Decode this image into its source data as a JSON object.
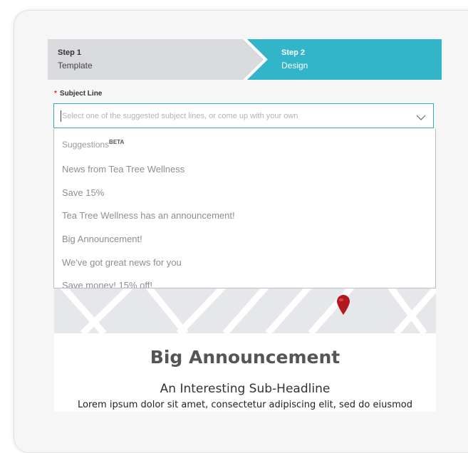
{
  "stepper": {
    "steps": [
      {
        "number": "Step 1",
        "name": "Template"
      },
      {
        "number": "Step 2",
        "name": "Design"
      }
    ],
    "colors": {
      "inactive": "#d9dade",
      "active": "#33b5c9"
    }
  },
  "subject": {
    "label": "Subject Line",
    "required_mark": "*",
    "placeholder": "Select one of the suggested subject lines, or come up with your own",
    "chevron_icon": "chevron-down-icon"
  },
  "suggestions": {
    "header": "Suggestions",
    "badge": "BETA",
    "items": [
      "News from Tea Tree Wellness",
      "Save 15%",
      "Tea Tree Wellness has an announcement!",
      "Big Announcement!",
      "We've got great news for you",
      "Save money! 15% off!"
    ]
  },
  "preview": {
    "map_icon": "map-pin-icon",
    "headline": "Big Announcement",
    "subheadline": "An Interesting Sub-Headline",
    "body": "Lorem ipsum dolor sit amet, consectetur adipiscing elit, sed do eiusmod"
  }
}
